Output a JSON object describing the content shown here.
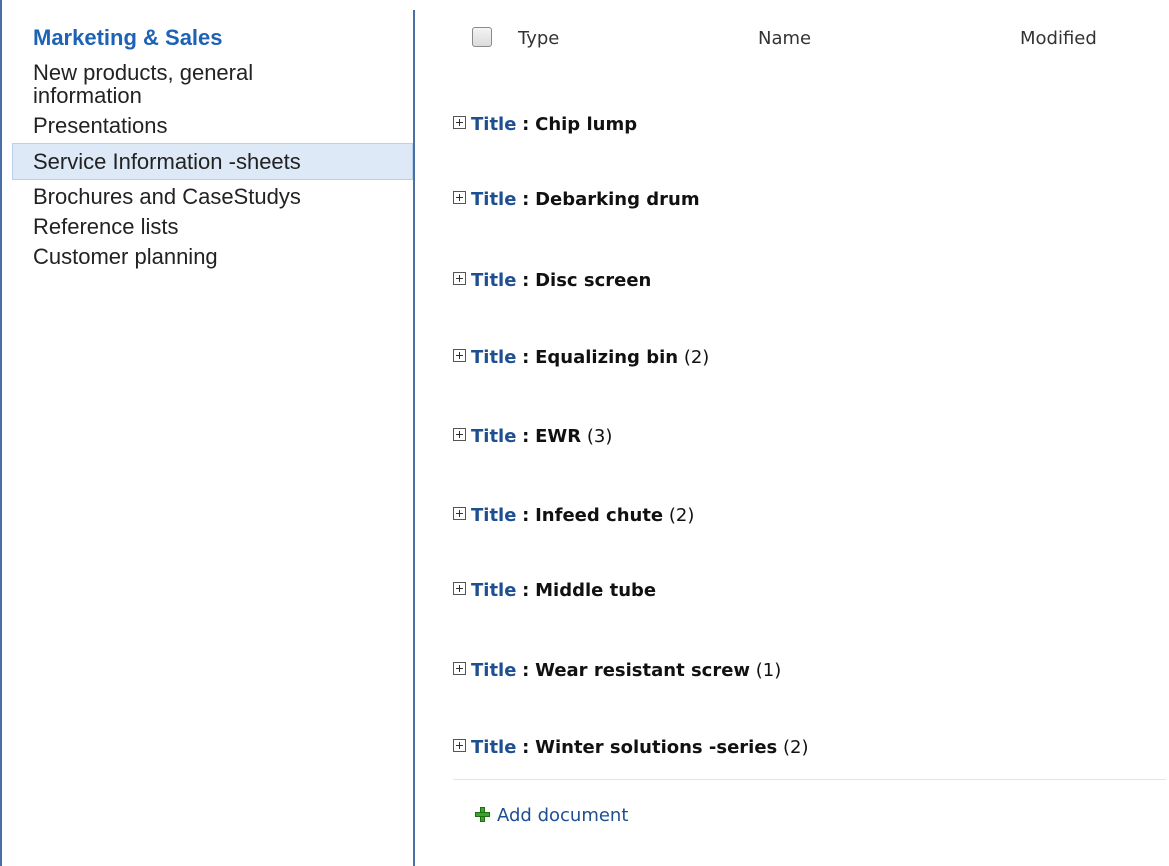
{
  "nav": {
    "heading": "Marketing & Sales",
    "items": [
      "New products, general information",
      "Presentations",
      "Service Information -sheets",
      "Brochures and CaseStudys",
      "Reference lists",
      "Customer planning"
    ],
    "selected": "Service Information -sheets"
  },
  "list": {
    "columns": {
      "type": "Type",
      "name": "Name",
      "modified": "Modified"
    },
    "group_field": "Title",
    "separator": ":",
    "groups": [
      {
        "value": "Chip lump",
        "count": ""
      },
      {
        "value": "Debarking drum",
        "count": ""
      },
      {
        "value": "Disc screen",
        "count": ""
      },
      {
        "value": "Equalizing bin",
        "count": "(2)"
      },
      {
        "value": "EWR",
        "count": "(3)"
      },
      {
        "value": "Infeed chute",
        "count": "(2)"
      },
      {
        "value": "Middle tube",
        "count": ""
      },
      {
        "value": "Wear resistant screw",
        "count": "(1)"
      },
      {
        "value": "Winter solutions -series",
        "count": "(2)"
      }
    ],
    "add_document_label": "Add document"
  },
  "colors": {
    "accent": "#1d62b4",
    "selected_bg": "#dde9f7",
    "add_icon": "#3aa52b"
  }
}
